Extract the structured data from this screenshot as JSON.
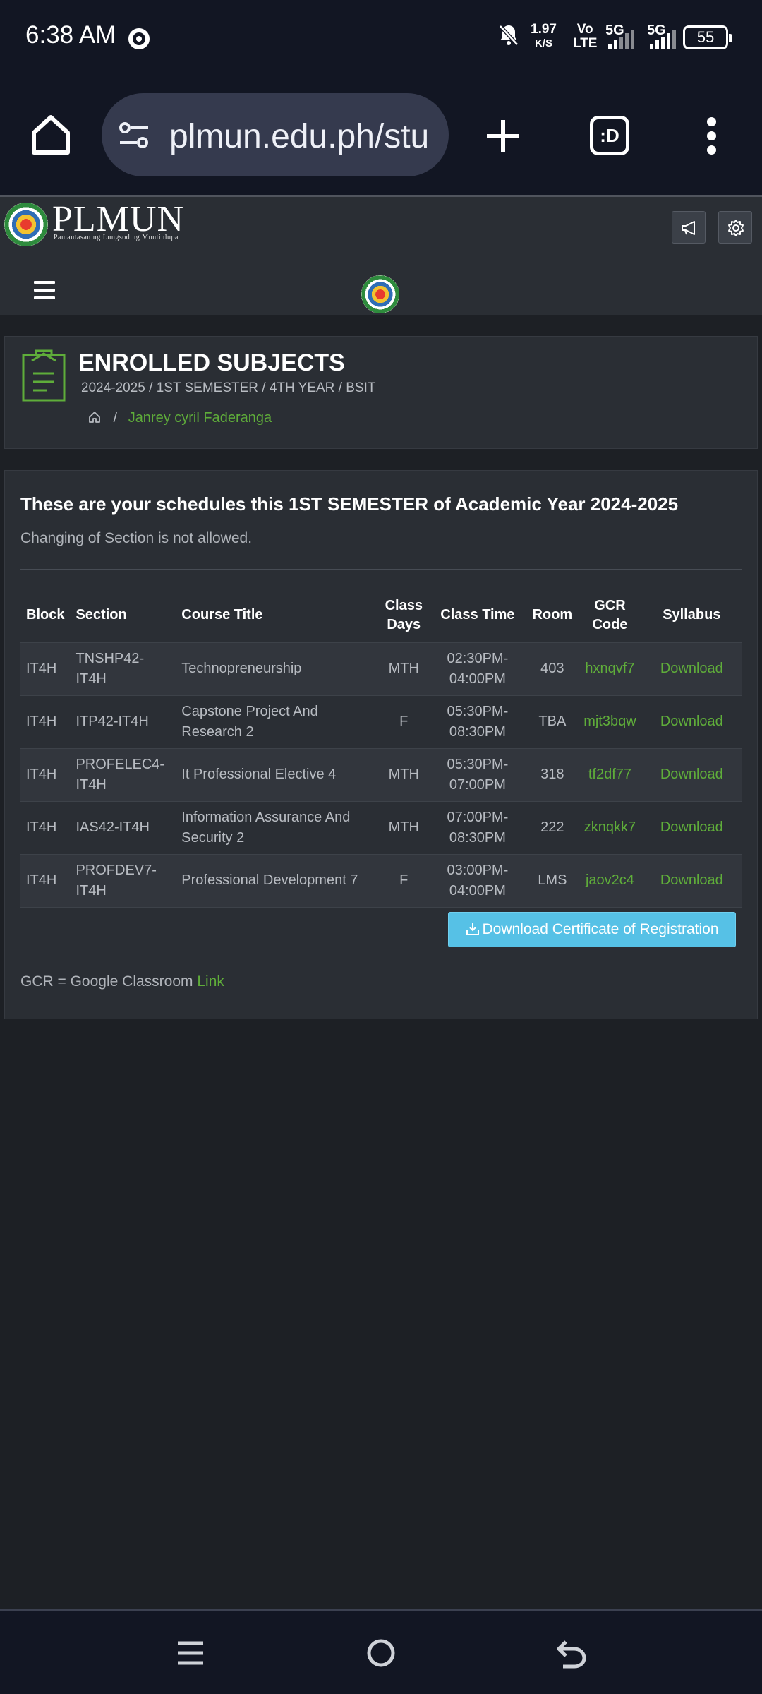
{
  "status": {
    "time": "6:38 AM",
    "speed_value": "1.97",
    "speed_unit": "K/S",
    "volte_top": "Vo",
    "volte_bottom": "LTE",
    "net1": "5G",
    "net2": "5G",
    "battery": "55"
  },
  "browser": {
    "url": "plmun.edu.ph/stu",
    "tabs_label": ":D"
  },
  "site": {
    "logo_text": "PLMUN",
    "logo_subtitle": "Pamantasan ng Lungsod ng Muntinlupa"
  },
  "title_card": {
    "title": "ENROLLED SUBJECTS",
    "subtitle": "2024-2025 / 1ST SEMESTER / 4TH YEAR / BSIT",
    "breadcrumb_sep": "/",
    "student_name": "Janrey cyril Faderanga"
  },
  "schedule": {
    "heading": "These are your schedules this 1ST SEMESTER of Academic Year 2024-2025",
    "note": "Changing of Section is not allowed.",
    "columns": {
      "block": "Block",
      "section": "Section",
      "course_title": "Course Title",
      "class_days": "Class Days",
      "class_time": "Class Time",
      "room": "Room",
      "gcr_code": "GCR Code",
      "syllabus": "Syllabus"
    },
    "rows": [
      {
        "block": "IT4H",
        "section": "TNSHP42-IT4H",
        "course": "Technopreneurship",
        "days": "MTH",
        "time": "02:30PM-04:00PM",
        "room": "403",
        "gcr": "hxnqvf7",
        "syllabus": "Download"
      },
      {
        "block": "IT4H",
        "section": "ITP42-IT4H",
        "course": "Capstone Project And Research 2",
        "days": "F",
        "time": "05:30PM-08:30PM",
        "room": "TBA",
        "gcr": "mjt3bqw",
        "syllabus": "Download"
      },
      {
        "block": "IT4H",
        "section": "PROFELEC4-IT4H",
        "course": "It Professional Elective 4",
        "days": "MTH",
        "time": "05:30PM-07:00PM",
        "room": "318",
        "gcr": "tf2df77",
        "syllabus": "Download"
      },
      {
        "block": "IT4H",
        "section": "IAS42-IT4H",
        "course": "Information Assurance And Security 2",
        "days": "MTH",
        "time": "07:00PM-08:30PM",
        "room": "222",
        "gcr": "zknqkk7",
        "syllabus": "Download"
      },
      {
        "block": "IT4H",
        "section": "PROFDEV7-IT4H",
        "course": "Professional Development 7",
        "days": "F",
        "time": "03:00PM-04:00PM",
        "room": "LMS",
        "gcr": "jaov2c4",
        "syllabus": "Download"
      }
    ],
    "certificate_button": "Download Certificate of Registration",
    "gcr_legend": "GCR = Google Classroom",
    "gcr_link": "Link"
  },
  "icons": [
    "chrome-icon",
    "bell-off-icon",
    "home-icon",
    "tune-icon",
    "plus-icon",
    "more-vert-icon",
    "megaphone-icon",
    "gear-icon",
    "menu-icon",
    "clipboard-icon",
    "download-icon",
    "recents-icon",
    "home-circle-icon",
    "back-icon"
  ],
  "colors": {
    "accent_green": "#5fad3a",
    "button_blue": "#56c1e6",
    "card_bg": "#2a2e34",
    "page_bg": "#1d2025"
  }
}
